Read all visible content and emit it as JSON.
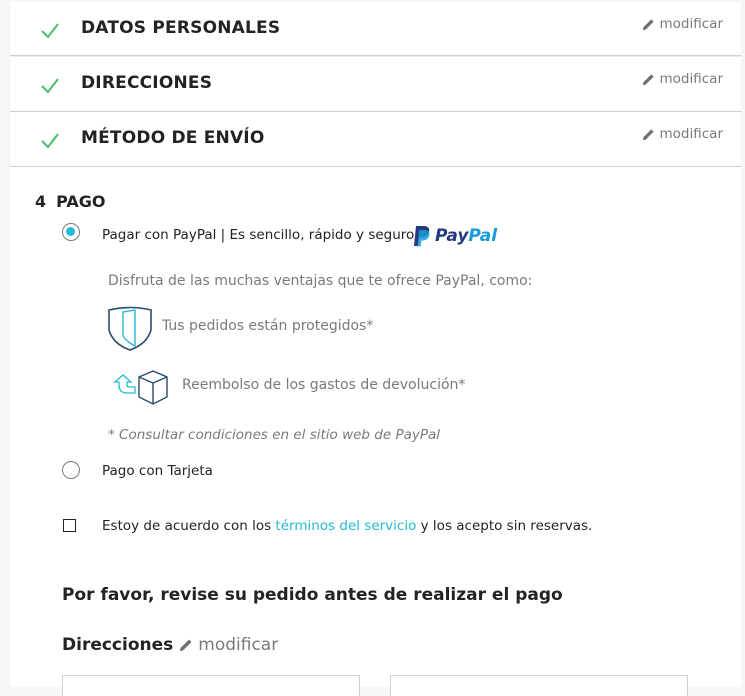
{
  "steps": [
    {
      "title": "DATOS PERSONALES",
      "edit_label": "modificar"
    },
    {
      "title": "DIRECCIONES",
      "edit_label": "modificar"
    },
    {
      "title": "MÉTODO DE ENVÍO",
      "edit_label": "modificar"
    }
  ],
  "payment": {
    "step_number": "4",
    "title": "PAGO",
    "paypal_option": {
      "label": "Pagar con PayPal | Es sencillo, rápido y seguro",
      "logo_text_1": "Pay",
      "logo_text_2": "Pal",
      "selected": true,
      "intro": "Disfruta de las muchas ventajas que te ofrece PayPal, como:",
      "benefit_1": "Tus pedidos están protegidos*",
      "benefit_2": "Reembolso de los gastos de devolución*",
      "note": "* Consultar condiciones en el sitio web de PayPal"
    },
    "card_option": {
      "label": "Pago con Tarjeta",
      "selected": false
    },
    "terms": {
      "prefix": "Estoy de acuerdo con los ",
      "link": "términos del servicio",
      "suffix": " y los acepto sin reservas.",
      "checked": false
    }
  },
  "review": {
    "heading": "Por favor, revise su pedido antes de realizar el pago",
    "addresses_label": "Direcciones",
    "edit_label": "modificar"
  },
  "colors": {
    "check": "#4cbb6c",
    "accent": "#24b9d7",
    "paypal_dark": "#253b80",
    "paypal_light": "#179bd7"
  }
}
